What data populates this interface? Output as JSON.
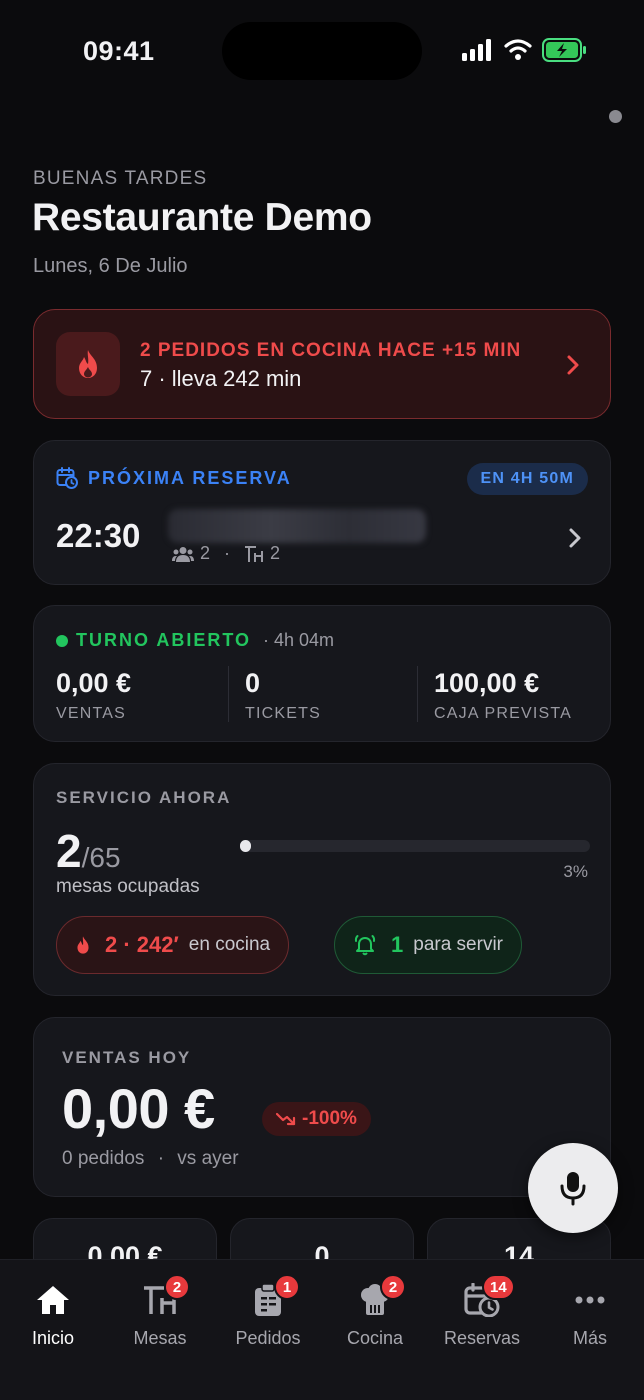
{
  "status_bar": {
    "time": "09:41"
  },
  "header": {
    "greeting": "BUENAS TARDES",
    "restaurant_name": "Restaurante Demo",
    "date": "Lunes, 6 De Julio"
  },
  "kitchen_alert": {
    "title": "2 PEDIDOS EN COCINA HACE +15 MIN",
    "detail": "7 · lleva 242 min"
  },
  "next_reservation": {
    "label": "PRÓXIMA RESERVA",
    "eta": "EN 4H 50M",
    "time": "22:30",
    "guests": "2",
    "separator": "·",
    "table": "2"
  },
  "shift": {
    "label": "TURNO ABIERTO",
    "duration": "· 4h 04m",
    "stats": [
      {
        "value": "0,00 €",
        "label": "VENTAS"
      },
      {
        "value": "0",
        "label": "TICKETS"
      },
      {
        "value": "100,00 €",
        "label": "CAJA PREVISTA"
      }
    ]
  },
  "service": {
    "title": "SERVICIO AHORA",
    "occupied": "2",
    "total": "/65",
    "sub": "mesas ocupadas",
    "occupancy_fraction": 0.03,
    "percent": "3%",
    "kitchen_chip": {
      "value": "2 · 242′",
      "text": "en cocina"
    },
    "serve_chip": {
      "value": "1",
      "text": "para servir"
    }
  },
  "sales_today": {
    "title": "VENTAS HOY",
    "amount": "0,00 €",
    "delta": "-100%",
    "orders": "0 pedidos",
    "separator": "·",
    "compare": "vs ayer"
  },
  "mini_stats": [
    "0,00 €",
    "0",
    "14"
  ],
  "tabs": [
    {
      "label": "Inicio",
      "icon": "home-icon"
    },
    {
      "label": "Mesas",
      "icon": "table-icon",
      "badge": "2"
    },
    {
      "label": "Pedidos",
      "icon": "clipboard-icon",
      "badge": "1"
    },
    {
      "label": "Cocina",
      "icon": "chef-hat-icon",
      "badge": "2"
    },
    {
      "label": "Reservas",
      "icon": "calendar-clock-icon",
      "badge": "14"
    },
    {
      "label": "Más",
      "icon": "more-icon"
    }
  ],
  "colors": {
    "background": "#0b0b0d",
    "card": "#16171c",
    "alert_red": "#ef4b4b",
    "reservation_blue": "#3b82f6",
    "shift_green": "#22c55e",
    "badge_red": "#e8393c"
  }
}
